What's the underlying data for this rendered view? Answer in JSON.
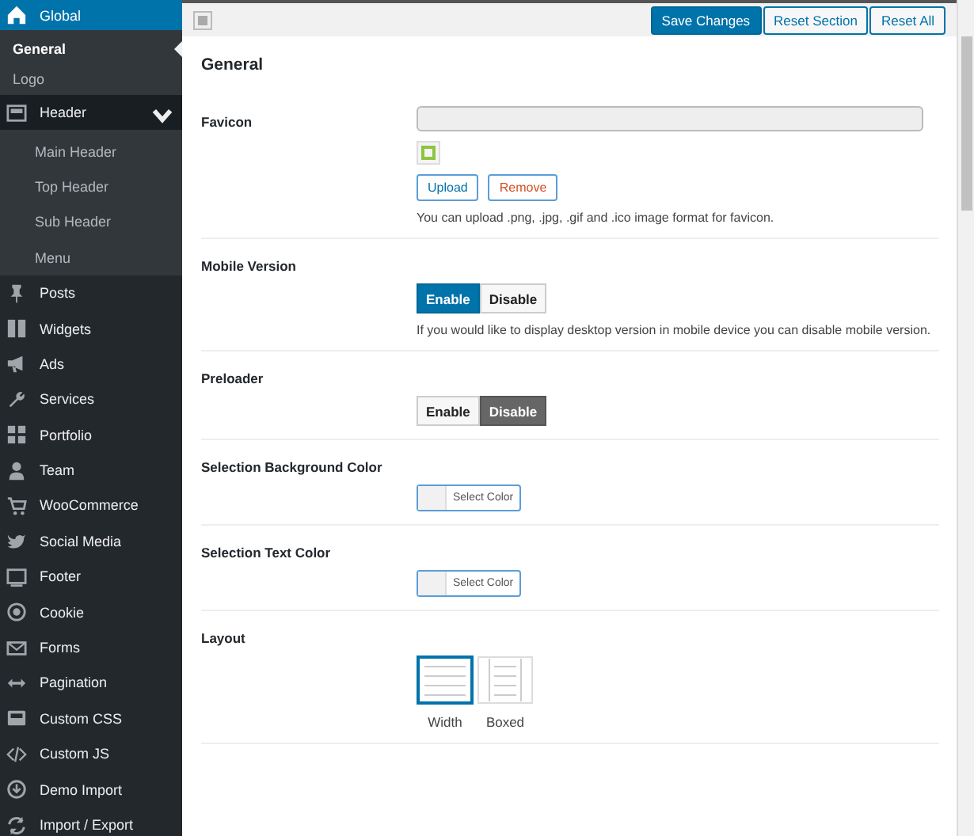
{
  "sidebar": {
    "items": [
      {
        "label": "Global",
        "selected": true,
        "expanded": true,
        "children": [
          {
            "label": "General",
            "selected": true
          },
          {
            "label": "Logo",
            "selected": false
          }
        ]
      },
      {
        "label": "Header",
        "selected": false,
        "expanded": true,
        "children": [
          {
            "label": "Main Header",
            "selected": false
          },
          {
            "label": "Top Header",
            "selected": false
          },
          {
            "label": "Sub Header",
            "selected": false
          },
          {
            "label": "Menu",
            "selected": false
          }
        ]
      },
      {
        "label": "Posts",
        "selected": false
      },
      {
        "label": "Widgets",
        "selected": false
      },
      {
        "label": "Ads",
        "selected": false
      },
      {
        "label": "Services",
        "selected": false
      },
      {
        "label": "Portfolio",
        "selected": false
      },
      {
        "label": "Team",
        "selected": false
      },
      {
        "label": "WooCommerce",
        "selected": false
      },
      {
        "label": "Social Media",
        "selected": false
      },
      {
        "label": "Footer",
        "selected": false
      },
      {
        "label": "Cookie",
        "selected": false
      },
      {
        "label": "Forms",
        "selected": false
      },
      {
        "label": "Pagination",
        "selected": false
      },
      {
        "label": "Custom CSS",
        "selected": false
      },
      {
        "label": "Custom JS",
        "selected": false
      },
      {
        "label": "Demo Import",
        "selected": false
      },
      {
        "label": "Import / Export",
        "selected": false
      }
    ]
  },
  "toolbar": {
    "buttons": [
      {
        "label": "Save Changes",
        "kind": "primary"
      },
      {
        "label": "Reset Section",
        "kind": "secondary"
      },
      {
        "label": "Reset All",
        "kind": "secondary"
      }
    ]
  },
  "section": {
    "title": "General",
    "fields": [
      {
        "kind": "media",
        "label": "Favicon",
        "buttons": [
          {
            "label": "Upload",
            "kind": "upload"
          },
          {
            "label": "Remove",
            "kind": "remove"
          }
        ],
        "description": "You can upload .png, .jpg, .gif and .ico image format for favicon."
      },
      {
        "kind": "toggle",
        "label": "Mobile Version",
        "options": [
          {
            "label": "Enable",
            "selected": true
          },
          {
            "label": "Disable",
            "selected": false
          }
        ],
        "description": "If you would like to display desktop version in mobile device you can disable mobile version."
      },
      {
        "kind": "toggle",
        "label": "Preloader",
        "options": [
          {
            "label": "Enable",
            "selected": false
          },
          {
            "label": "Disable",
            "selected": true
          }
        ]
      },
      {
        "kind": "color",
        "label": "Selection Background Color",
        "button": "Select Color"
      },
      {
        "kind": "color",
        "label": "Selection Text Color",
        "button": "Select Color"
      },
      {
        "kind": "image_select",
        "label": "Layout",
        "options": [
          {
            "label": "Width",
            "selected": true
          },
          {
            "label": "Boxed",
            "selected": false
          }
        ]
      }
    ]
  }
}
